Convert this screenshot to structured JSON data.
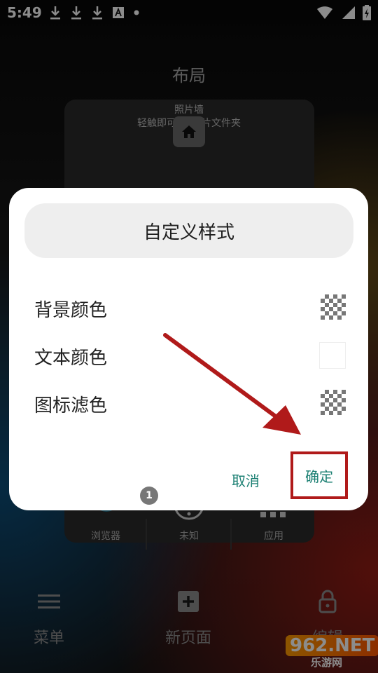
{
  "status_bar": {
    "time": "5:49",
    "icons_left": [
      "download-icon",
      "download-icon",
      "download-icon",
      "a-box-icon",
      "dot-icon"
    ],
    "icons_right": [
      "wifi-icon",
      "signal-icon",
      "battery-charging-icon"
    ]
  },
  "page": {
    "title": "布局"
  },
  "preview": {
    "label_line1": "照片墙",
    "label_line2": "轻触即可",
    "label_line2_tail": "片文件夹",
    "dock": [
      {
        "label": "浏览器"
      },
      {
        "label": "未知"
      },
      {
        "label": "应用"
      }
    ]
  },
  "dialog": {
    "title": "自定义样式",
    "rows": [
      {
        "label": "背景颜色",
        "swatch": "checker"
      },
      {
        "label": "文本颜色",
        "swatch": "white"
      },
      {
        "label": "图标滤色",
        "swatch": "checker"
      }
    ],
    "cancel_label": "取消",
    "ok_label": "确定",
    "badge": "1",
    "accent_color": "#1a7f72",
    "highlight_color": "#b01a1a"
  },
  "bottom_nav": [
    {
      "label": "菜单",
      "icon": "menu-icon"
    },
    {
      "label": "新页面",
      "icon": "add-page-icon"
    },
    {
      "label": "编辑",
      "icon": "lock-icon"
    }
  ],
  "watermark": {
    "line1": "962.NET",
    "line2": "乐游网"
  }
}
